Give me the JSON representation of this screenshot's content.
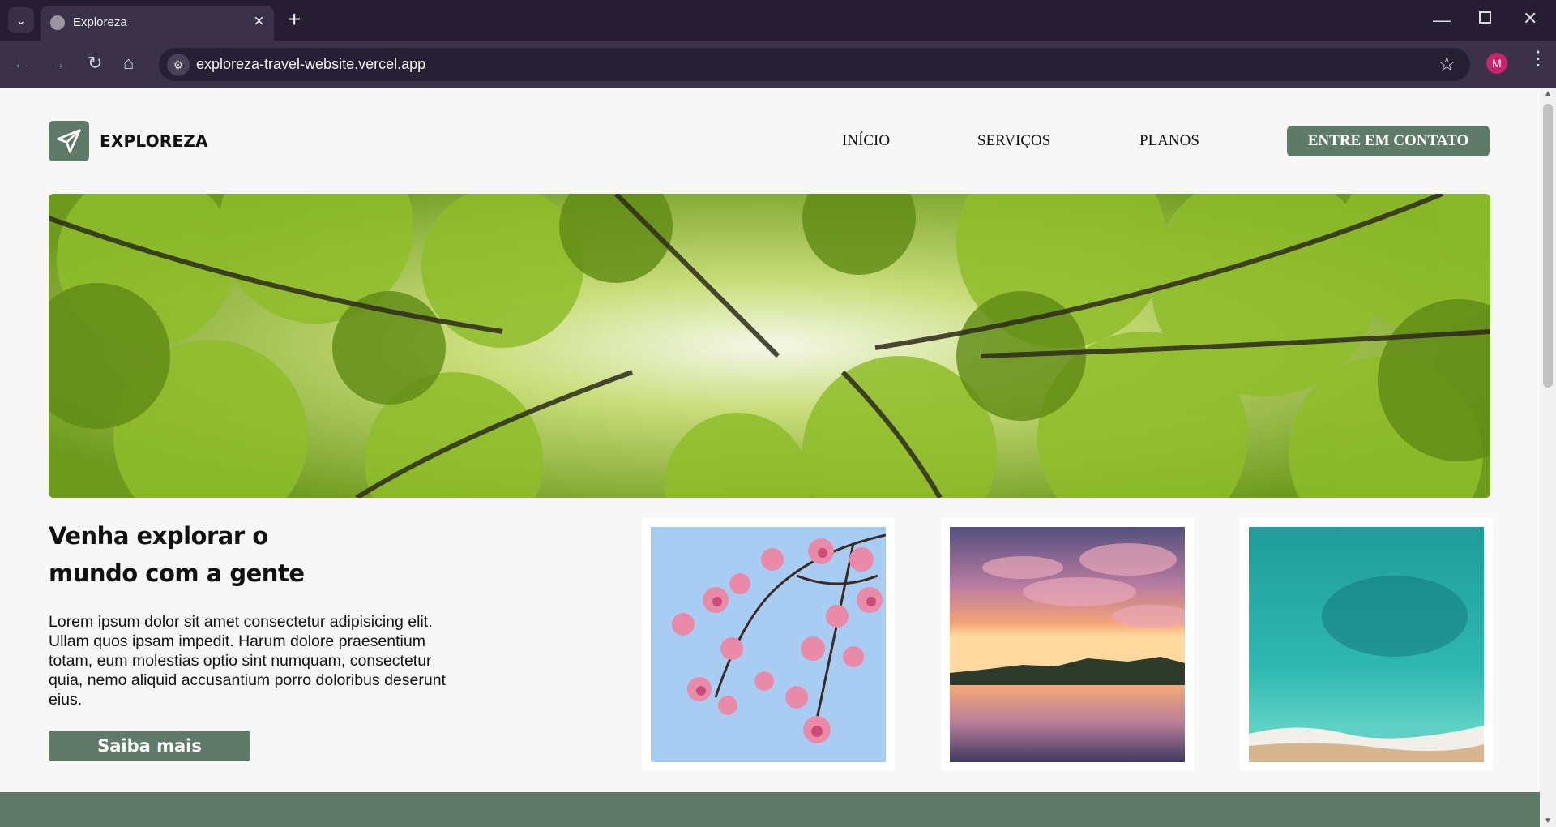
{
  "browser": {
    "tab_title": "Exploreza",
    "url": "exploreza-travel-website.vercel.app",
    "profile_initial": "M"
  },
  "site": {
    "brand": "EXPLOREZA",
    "nav": [
      "INÍCIO",
      "SERVIÇOS",
      "PLANOS"
    ],
    "contact_button": "ENTRE EM CONTATO",
    "headline_line1": "Venha explorar o",
    "headline_line2": "mundo com a gente",
    "body": "Lorem ipsum dolor sit amet consectetur adipisicing elit. Ullam quos ipsam impedit. Harum dolore praesentium totam, eum molestias optio sint numquam, consectetur quia, nemo aliquid accusantium porro doloribus deserunt eius.",
    "cta": "Saiba mais"
  },
  "colors": {
    "brand_green": "#5f7a68",
    "browser_dark": "#271d33"
  },
  "images": [
    "forest-canopy-photo",
    "cherry-blossom-photo",
    "sunset-lake-photo",
    "turquoise-beach-photo"
  ]
}
